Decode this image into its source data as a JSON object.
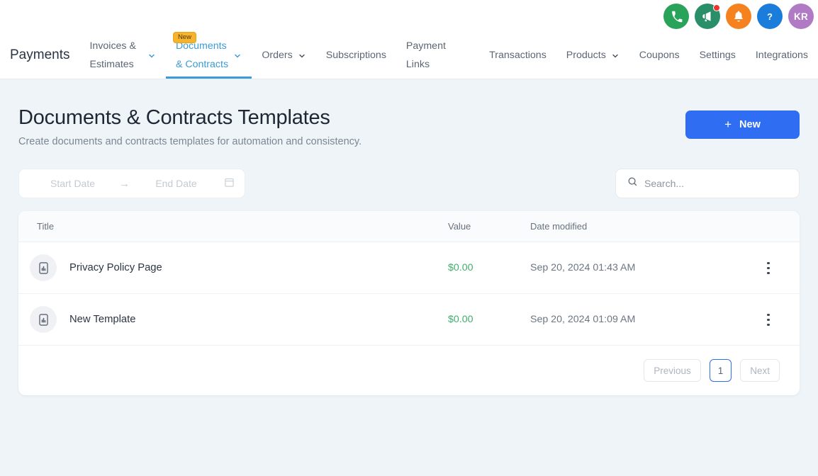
{
  "topbar": {
    "brand": "Payments",
    "nav": [
      {
        "label": "Invoices & Estimates",
        "caret": true,
        "active": false,
        "badge": null
      },
      {
        "label": "Documents & Contracts",
        "caret": true,
        "active": true,
        "badge": "New"
      },
      {
        "label": "Orders",
        "caret": true,
        "active": false,
        "badge": null
      },
      {
        "label": "Subscriptions",
        "caret": false,
        "active": false,
        "badge": null
      },
      {
        "label": "Payment Links",
        "caret": false,
        "active": false,
        "badge": null
      },
      {
        "label": "Transactions",
        "caret": false,
        "active": false,
        "badge": null
      },
      {
        "label": "Products",
        "caret": true,
        "active": false,
        "badge": null
      },
      {
        "label": "Coupons",
        "caret": false,
        "active": false,
        "badge": null
      },
      {
        "label": "Settings",
        "caret": false,
        "active": false,
        "badge": null
      },
      {
        "label": "Integrations",
        "caret": false,
        "active": false,
        "badge": null
      }
    ],
    "utility_icons": [
      {
        "name": "phone-icon",
        "color": "#2aa35a",
        "has_badge": false
      },
      {
        "name": "megaphone-icon",
        "color": "#2a8f68",
        "has_badge": true
      },
      {
        "name": "bell-icon",
        "color": "#f5821f",
        "has_badge": false
      },
      {
        "name": "help-icon",
        "color": "#1b7ddb",
        "has_badge": false
      }
    ],
    "avatar_initials": "KR"
  },
  "page": {
    "title": "Documents & Contracts Templates",
    "subtitle": "Create documents and contracts templates for automation and consistency.",
    "new_button": {
      "label": "New",
      "plus": "+"
    }
  },
  "filters": {
    "start_date_placeholder": "Start Date",
    "range_arrow": "→",
    "end_date_placeholder": "End Date",
    "search_placeholder": "Search...",
    "search_value": ""
  },
  "table": {
    "columns": [
      "Title",
      "Value",
      "Date modified"
    ],
    "rows": [
      {
        "title": "Privacy Policy Page",
        "value": "$0.00",
        "date": "Sep 20, 2024 01:43 AM"
      },
      {
        "title": "New Template",
        "value": "$0.00",
        "date": "Sep 20, 2024 01:09 AM"
      }
    ]
  },
  "pagination": {
    "previous": "Previous",
    "current_page": "1",
    "next": "Next"
  },
  "colors": {
    "accent_blue": "#2f6ef2",
    "active_tab": "#3b9bd6",
    "value_green": "#3fae6b",
    "badge_amber": "#f7b32b",
    "page_bg": "#eff4f8"
  }
}
